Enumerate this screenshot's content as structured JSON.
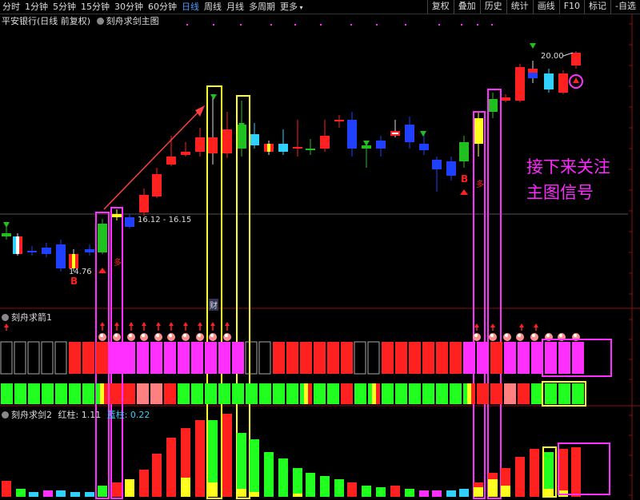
{
  "toolbar": {
    "tabs": [
      "分时",
      "1分钟",
      "5分钟",
      "15分钟",
      "30分钟",
      "60分钟",
      "日线",
      "周线",
      "月线",
      "多周期",
      "更多"
    ],
    "active_tab": "日线",
    "right_buttons": [
      "复权",
      "叠加",
      "历史",
      "统计",
      "画线",
      "F10",
      "标记",
      "-自选"
    ]
  },
  "main_chart": {
    "stock_title": "平安银行(日线 前复权)",
    "indicator_name": "刻舟求剑主图",
    "price_label_high": "20.00",
    "price_label_range": "16.12 - 16.15",
    "price_label_low": "14.76",
    "buy_signal_text": "B",
    "duo_text": "多",
    "cai_text": "财"
  },
  "panel_arrow": {
    "name": "刻舟求箭1"
  },
  "panel_sword": {
    "name": "刻舟求剑2",
    "red_label": "红柱: 1.11",
    "blue_label": "蓝柱: 0.22"
  },
  "annotation": {
    "line1": "接下来关注",
    "line2": "主图信号"
  },
  "colors": {
    "up": "#ff2020",
    "down": "#2040ff",
    "flat_green": "#20c020",
    "magenta": "#ff30ff",
    "yellow": "#ffff20",
    "cyan": "#30d0ff"
  }
}
